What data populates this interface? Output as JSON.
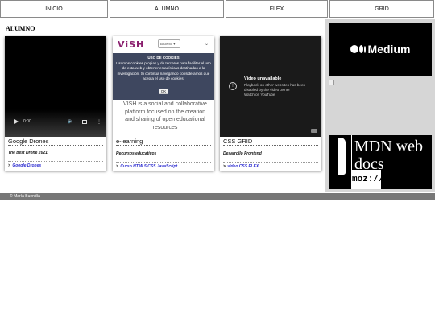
{
  "nav": {
    "items": [
      "INICIO",
      "ALUMNO",
      "FLEX",
      "GRID"
    ]
  },
  "main": {
    "section_title": "ALUMNO",
    "cards": [
      {
        "title": "Google Drones",
        "subtitle": "The best Drone 2021",
        "link": "Google Drones",
        "video": {
          "time": "0:00"
        }
      },
      {
        "title": "e-learning",
        "subtitle": "Recursos educativos",
        "link": "Curso HTML5 CSS JavaScript",
        "embed": {
          "logo": "ViSH",
          "browse_label": "Browse",
          "description": "VISH is a social and collaborative platform focused on the creation and sharing of open educational resources",
          "cookie_title": "USO DE COOKIES",
          "cookie_text": "Usamos cookies propias y de terceros para facilitar el uso de esta web y obtener estadísticas destinadas a la investigación. Si continúa navegando consideramos que acepta el uso de cookies.",
          "cookie_ok": "OK"
        }
      },
      {
        "title": "CSS GRID",
        "subtitle": "Desarrollo Frontend",
        "link": "video CSS FLEX",
        "embed": {
          "heading": "Video unavailable",
          "text": "Playback on other websites has been disabled by the video owner",
          "link": "Watch on YouTube"
        }
      }
    ]
  },
  "aside": {
    "medium_word": "Medium",
    "mdn_text": "MDN web docs",
    "mdn_moz": "moz://a"
  },
  "footer": {
    "text": "© María Buendía"
  }
}
